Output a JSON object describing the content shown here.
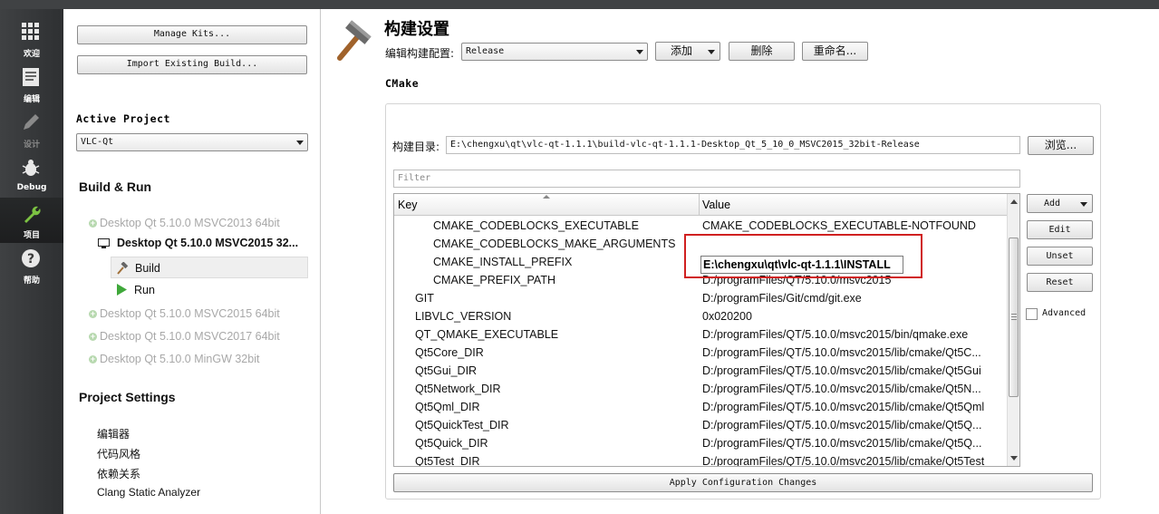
{
  "modebar": {
    "items": [
      {
        "label": "欢迎",
        "icon": "grid-icon"
      },
      {
        "label": "编辑",
        "icon": "document-icon"
      },
      {
        "label": "设计",
        "icon": "pen-icon"
      },
      {
        "label": "Debug",
        "icon": "bug-icon"
      },
      {
        "label": "项目",
        "icon": "wrench-icon"
      },
      {
        "label": "帮助",
        "icon": "help-icon"
      }
    ]
  },
  "left": {
    "manage_kits": "Manage Kits...",
    "import_build": "Import Existing Build...",
    "active_project_heading": "Active Project",
    "active_project_value": "VLC-Qt",
    "build_run_heading": "Build & Run",
    "kits": [
      "Desktop Qt 5.10.0 MSVC2013 64bit",
      "Desktop Qt 5.10.0 MSVC2015 32...",
      "Desktop Qt 5.10.0 MSVC2015 64bit",
      "Desktop Qt 5.10.0 MSVC2017 64bit",
      "Desktop Qt 5.10.0 MinGW 32bit"
    ],
    "build_label": "Build",
    "run_label": "Run",
    "project_settings_heading": "Project Settings",
    "project_settings": [
      "编辑器",
      "代码风格",
      "依赖关系",
      "Clang Static Analyzer"
    ]
  },
  "main": {
    "title": "构建设置",
    "edit_config_label": "编辑构建配置:",
    "config_value": "Release",
    "add_label": "添加",
    "delete_label": "删除",
    "rename_label": "重命名...",
    "cmake_heading": "CMake",
    "build_dir_label": "构建目录:",
    "build_dir_value": "E:\\chengxu\\qt\\vlc-qt-1.1.1\\build-vlc-qt-1.1.1-Desktop_Qt_5_10_0_MSVC2015_32bit-Release",
    "browse_label": "浏览...",
    "filter_placeholder": "Filter",
    "table": {
      "key_header": "Key",
      "value_header": "Value",
      "rows": [
        {
          "key": "CMAKE_CODEBLOCKS_EXECUTABLE",
          "value": "CMAKE_CODEBLOCKS_EXECUTABLE-NOTFOUND"
        },
        {
          "key": "CMAKE_CODEBLOCKS_MAKE_ARGUMENTS",
          "value": ""
        },
        {
          "key": "CMAKE_INSTALL_PREFIX",
          "value": "E:\\chengxu\\qt\\vlc-qt-1.1.1\\INSTALL"
        },
        {
          "key": "CMAKE_PREFIX_PATH",
          "value": "D:/programFiles/QT/5.10.0/msvc2015"
        },
        {
          "key": "GIT",
          "value": "D:/programFiles/Git/cmd/git.exe"
        },
        {
          "key": "LIBVLC_VERSION",
          "value": "0x020200"
        },
        {
          "key": "QT_QMAKE_EXECUTABLE",
          "value": "D:/programFiles/QT/5.10.0/msvc2015/bin/qmake.exe"
        },
        {
          "key": "Qt5Core_DIR",
          "value": "D:/programFiles/QT/5.10.0/msvc2015/lib/cmake/Qt5C..."
        },
        {
          "key": "Qt5Gui_DIR",
          "value": "D:/programFiles/QT/5.10.0/msvc2015/lib/cmake/Qt5Gui"
        },
        {
          "key": "Qt5Network_DIR",
          "value": "D:/programFiles/QT/5.10.0/msvc2015/lib/cmake/Qt5N..."
        },
        {
          "key": "Qt5Qml_DIR",
          "value": "D:/programFiles/QT/5.10.0/msvc2015/lib/cmake/Qt5Qml"
        },
        {
          "key": "Qt5QuickTest_DIR",
          "value": "D:/programFiles/QT/5.10.0/msvc2015/lib/cmake/Qt5Q..."
        },
        {
          "key": "Qt5Quick_DIR",
          "value": "D:/programFiles/QT/5.10.0/msvc2015/lib/cmake/Qt5Q..."
        },
        {
          "key": "Qt5Test_DIR",
          "value": "D:/programFiles/QT/5.10.0/msvc2015/lib/cmake/Qt5Test"
        }
      ]
    },
    "side_buttons": {
      "add": "Add",
      "edit": "Edit",
      "unset": "Unset",
      "reset": "Reset"
    },
    "advanced_label": "Advanced",
    "apply_label": "Apply Configuration Changes"
  }
}
